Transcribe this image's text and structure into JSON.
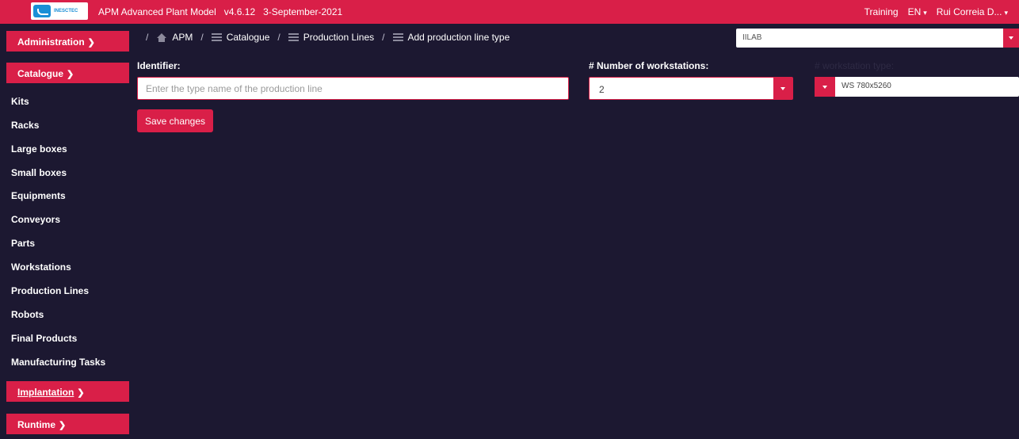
{
  "header": {
    "logo_text": "INESCTEC",
    "title": "APM Advanced Plant Model   v4.6.12   3-September-2021",
    "training": "Training",
    "language": "EN",
    "user": "Rui Correia D..."
  },
  "sidebar": {
    "administration": "Administration",
    "catalogue": "Catalogue",
    "items": [
      "Kits",
      "Racks",
      "Large boxes",
      "Small boxes",
      "Equipments",
      "Conveyors",
      "Parts",
      "Workstations",
      "Production Lines",
      "Robots",
      "Final Products",
      "Manufacturing Tasks"
    ],
    "implantation": "Implantation",
    "runtime": "Runtime"
  },
  "breadcrumb": {
    "apm": "APM",
    "catalogue": "Catalogue",
    "production_lines": "Production Lines",
    "current": "Add production line type"
  },
  "plant_select": {
    "value": "IILAB"
  },
  "form": {
    "identifier_label": "Identifier:",
    "identifier_placeholder": "Enter the type name of the production line",
    "workstations_label": "# Number of workstations:",
    "workstations_value": "2",
    "workstation_type_label": "# workstation type:",
    "workstation_type_value": "WS 780x5260",
    "save_label": "Save changes"
  },
  "colors": {
    "accent": "#d91f48",
    "background": "#1c1831"
  }
}
